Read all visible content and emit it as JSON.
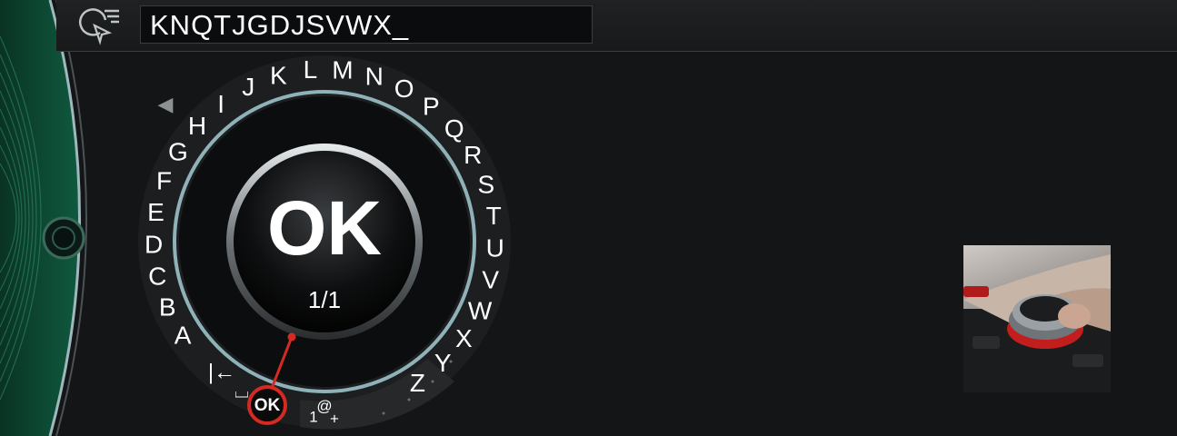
{
  "input": {
    "value": "KNQTJGDJSVWX_"
  },
  "speller": {
    "letters": [
      "A",
      "B",
      "C",
      "D",
      "E",
      "F",
      "G",
      "H",
      "I",
      "J",
      "K",
      "L",
      "M",
      "N",
      "O",
      "P",
      "Q",
      "R",
      "S",
      "T",
      "U",
      "V",
      "W",
      "X",
      "Y",
      "Z"
    ],
    "center_label": "OK",
    "page_indicator": "1/1",
    "ok_button_label": "OK",
    "special_chars_main": "1",
    "special_chars_super": "@",
    "special_chars_sub": "+",
    "backspace_symbol": "|←",
    "space_symbol": "⌴",
    "prev_arrow": "◀"
  },
  "icons": {
    "nav": "navigation-destination-list-icon",
    "back": "left-arrow-icon",
    "controller_photo": "idrive-controller-photo"
  },
  "colors": {
    "accent_red": "#d42a22",
    "ring_teal": "#8fb2b8",
    "left_green": "#0f5a3e"
  }
}
